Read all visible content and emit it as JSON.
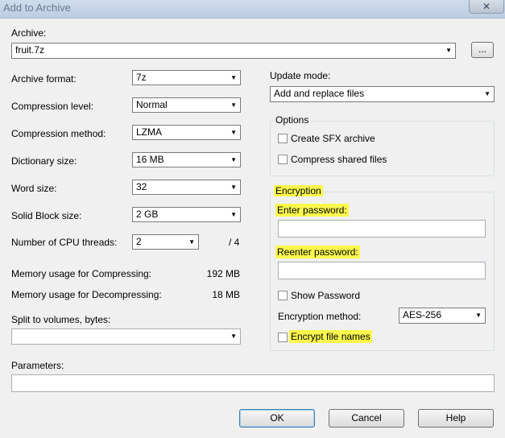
{
  "window": {
    "title": "Add to Archive",
    "close_glyph": "✕"
  },
  "archive": {
    "label": "Archive:",
    "value": "fruit.7z",
    "browse_label": "..."
  },
  "left": {
    "archive_format": {
      "label": "Archive format:",
      "value": "7z"
    },
    "compression_level": {
      "label": "Compression level:",
      "value": "Normal"
    },
    "compression_method": {
      "label": "Compression method:",
      "value": "LZMA"
    },
    "dictionary_size": {
      "label": "Dictionary size:",
      "value": "16 MB"
    },
    "word_size": {
      "label": "Word size:",
      "value": "32"
    },
    "solid_block_size": {
      "label": "Solid Block size:",
      "value": "2 GB"
    },
    "cpu_threads": {
      "label": "Number of CPU threads:",
      "value": "2",
      "max": "/ 4"
    },
    "memory_compress": {
      "label": "Memory usage for Compressing:",
      "value": "192 MB"
    },
    "memory_decompress": {
      "label": "Memory usage for Decompressing:",
      "value": "18 MB"
    },
    "split": {
      "label": "Split to volumes, bytes:",
      "value": ""
    }
  },
  "right": {
    "update_mode": {
      "label": "Update mode:",
      "value": "Add and replace files"
    },
    "options": {
      "title": "Options",
      "sfx": {
        "label": "Create SFX archive",
        "checked": false
      },
      "shared": {
        "label": "Compress shared files",
        "checked": false
      }
    },
    "encryption": {
      "title": "Encryption",
      "enter_password_label": "Enter password:",
      "reenter_password_label": "Reenter password:",
      "show_password": {
        "label": "Show Password",
        "checked": false
      },
      "method": {
        "label": "Encryption method:",
        "value": "AES-256"
      },
      "encrypt_names": {
        "label": "Encrypt file names",
        "checked": false
      }
    }
  },
  "parameters": {
    "label": "Parameters:",
    "value": ""
  },
  "buttons": {
    "ok": "OK",
    "cancel": "Cancel",
    "help": "Help"
  },
  "colors": {
    "highlight": "#fbf84d",
    "default_button_border": "#3c7fb1"
  },
  "icons": {
    "dropdown": "chevron-down-icon",
    "close": "close-icon"
  }
}
